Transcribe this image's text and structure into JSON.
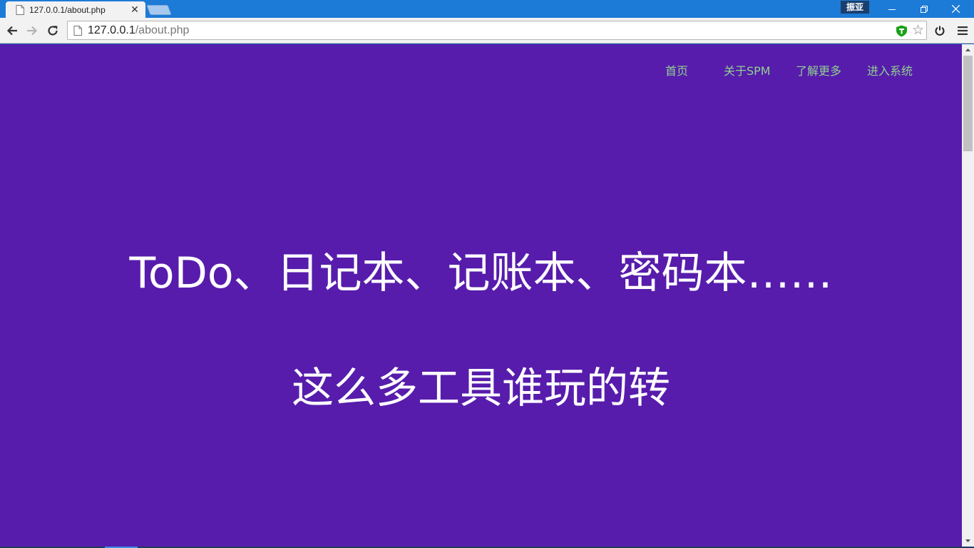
{
  "browser": {
    "tab": {
      "title": "127.0.0.1/about.php",
      "close_glyph": "✕"
    },
    "profile_name": "振亚",
    "address": {
      "host": "127.0.0.1",
      "path": "/about.php"
    },
    "icons": {
      "back": "back-arrow-icon",
      "forward": "forward-arrow-icon",
      "reload": "reload-icon",
      "page": "page-icon",
      "shield": "shield-icon",
      "bookmark": "star-icon",
      "power": "power-icon",
      "menu": "hamburger-menu-icon"
    }
  },
  "nav": {
    "items": [
      {
        "label": "首页"
      },
      {
        "label": "关于SPM"
      },
      {
        "label": "了解更多"
      },
      {
        "label": "进入系统"
      }
    ]
  },
  "hero": {
    "line1": "ToDo、日记本、记账本、密码本……",
    "line2": "这么多工具谁玩的转"
  },
  "colors": {
    "page_background": "#571cac",
    "nav_link": "#8fd08f",
    "hero_text": "#ffffff",
    "titlebar": "#1c7bd6"
  }
}
